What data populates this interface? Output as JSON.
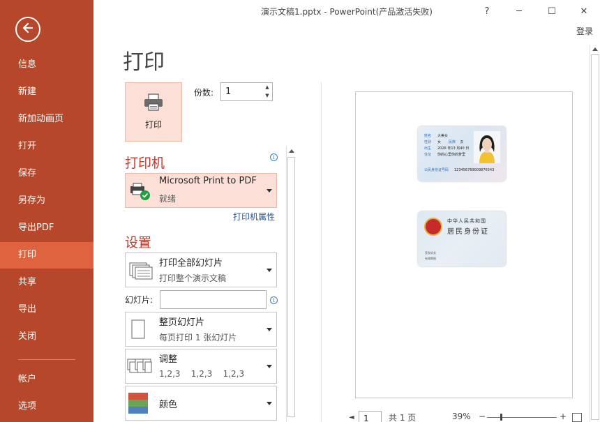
{
  "window": {
    "title": "演示文稿1.pptx - PowerPoint(产品激活失败)",
    "help": "?",
    "minimize": "─",
    "maximize": "☐",
    "close": "✕",
    "login": "登录"
  },
  "sidebar": {
    "back_icon": "back-arrow-icon",
    "items": [
      {
        "label": "信息"
      },
      {
        "label": "新建"
      },
      {
        "label": "新加动画页"
      },
      {
        "label": "打开"
      },
      {
        "label": "保存"
      },
      {
        "label": "另存为"
      },
      {
        "label": "导出PDF"
      },
      {
        "label": "打印",
        "active": true
      },
      {
        "label": "共享"
      },
      {
        "label": "导出"
      },
      {
        "label": "关闭"
      },
      {
        "label": "帐户"
      },
      {
        "label": "选项"
      }
    ]
  },
  "main": {
    "page_title": "打印",
    "print_button": "打印",
    "copies_label": "份数:",
    "copies_value": "1",
    "printer_section": "打印机",
    "printer": {
      "name": "Microsoft Print to PDF",
      "status": "就绪"
    },
    "printer_properties": "打印机属性",
    "settings_section": "设置",
    "settings": {
      "range": {
        "title": "打印全部幻灯片",
        "sub": "打印整个演示文稿"
      },
      "slides_label": "幻灯片:",
      "slides_value": "",
      "layout": {
        "title": "整页幻灯片",
        "sub": "每页打印 1 张幻灯片"
      },
      "collate": {
        "title": "调整",
        "sub": "1,2,3    1,2,3    1,2,3"
      },
      "color": {
        "title": "颜色"
      }
    }
  },
  "preview": {
    "id_front": {
      "name_label": "姓名",
      "name_value": "大美女",
      "sex_label": "性别",
      "sex_value": "女",
      "ethnic_label": "民族",
      "ethnic_value": "汉",
      "birth_label": "出生",
      "birth_value": "2026 年13 月40 日",
      "address_label": "住址",
      "address_value": "你的心里你的梦里",
      "id_label": "公民身份证号码",
      "id_value": "123456789009876543"
    },
    "id_back": {
      "line1": "中华人民共和国",
      "line2": "居民身份证",
      "issuer_label": "签发机关",
      "valid_label": "有效期限"
    },
    "footer": {
      "page_value": "1",
      "page_total": "共 1 页",
      "zoom": "39%"
    }
  },
  "colors": {
    "sidebar": "#b7472a",
    "sidebar_active": "#e0633f",
    "accent_text": "#c0392b",
    "highlight_bg": "#fcdfd6"
  }
}
